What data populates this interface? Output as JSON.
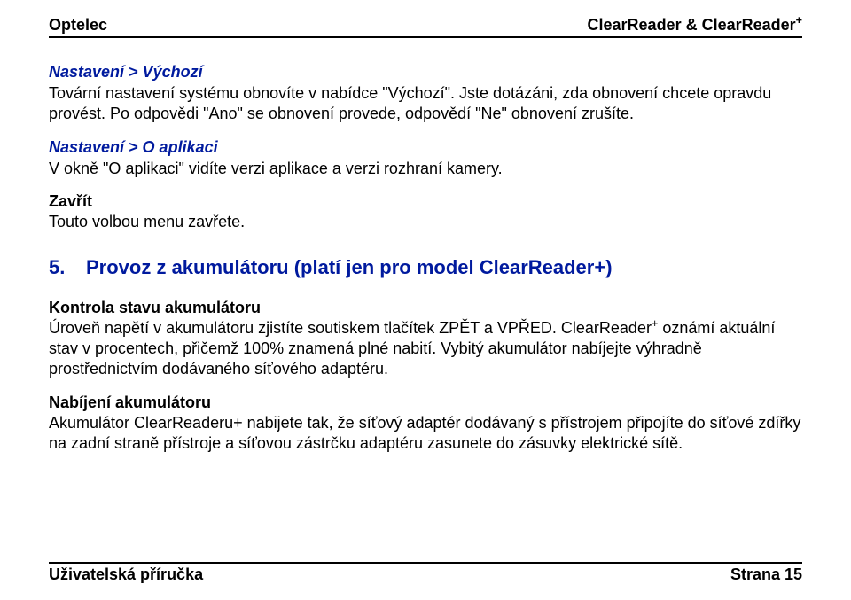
{
  "header": {
    "left": "Optelec",
    "right_prefix": "ClearReader & ClearReader",
    "right_sup": "+"
  },
  "sections": {
    "s1": {
      "heading": "Nastavení > Výchozí",
      "body": "Tovární nastavení systému obnovíte v nabídce \"Výchozí\". Jste dotázáni, zda obnovení chcete opravdu provést. Po odpovědi \"Ano\" se obnovení provede, odpovědí \"Ne\" obnovení zrušíte."
    },
    "s2": {
      "heading": "Nastavení > O aplikaci",
      "body": "V okně \"O aplikaci\" vidíte verzi aplikace a verzi rozhraní kamery."
    },
    "s3": {
      "heading": "Zavřít",
      "body": "Touto volbou menu zavřete."
    },
    "main": {
      "num": "5.",
      "title": "Provoz z akumulátoru (platí jen pro model ClearReader+)"
    },
    "s4": {
      "heading": "Kontrola stavu akumulátoru",
      "body_pre": "Úroveň napětí v akumulátoru zjistíte soutiskem tlačítek ZPĚT a VPŘED. ClearReader",
      "body_sup": "+",
      "body_post": " oznámí aktuální stav v procentech, přičemž 100% znamená plné nabití. Vybitý akumulátor nabíjejte výhradně prostřednictvím dodávaného síťového adaptéru."
    },
    "s5": {
      "heading": "Nabíjení akumulátoru",
      "body": "Akumulátor ClearReaderu+ nabijete tak, že síťový adaptér dodávaný s přístrojem připojíte do síťové zdířky na zadní straně přístroje a síťovou zástrčku adaptéru zasunete do zásuvky elektrické sítě."
    }
  },
  "footer": {
    "left": "Uživatelská příručka",
    "right": "Strana 15"
  }
}
